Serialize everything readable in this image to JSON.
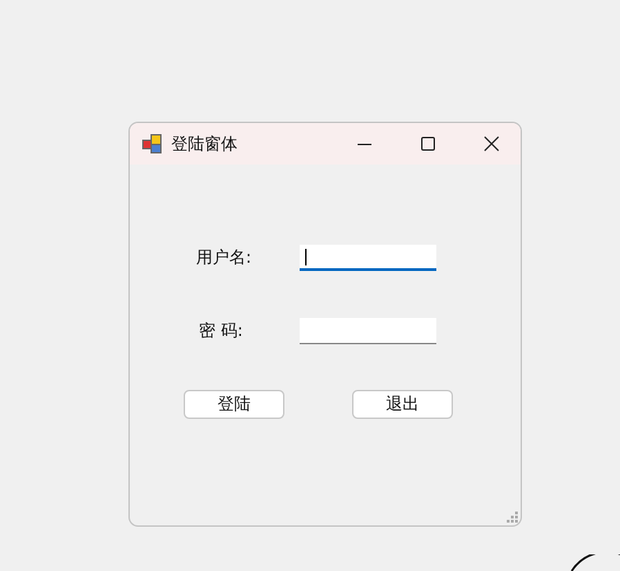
{
  "window": {
    "title": "登陆窗体"
  },
  "fields": [
    {
      "label": "用户名:",
      "focused": true
    },
    {
      "label": "密 码:",
      "focused": false
    }
  ],
  "buttons": [
    "登陆",
    "退出"
  ]
}
